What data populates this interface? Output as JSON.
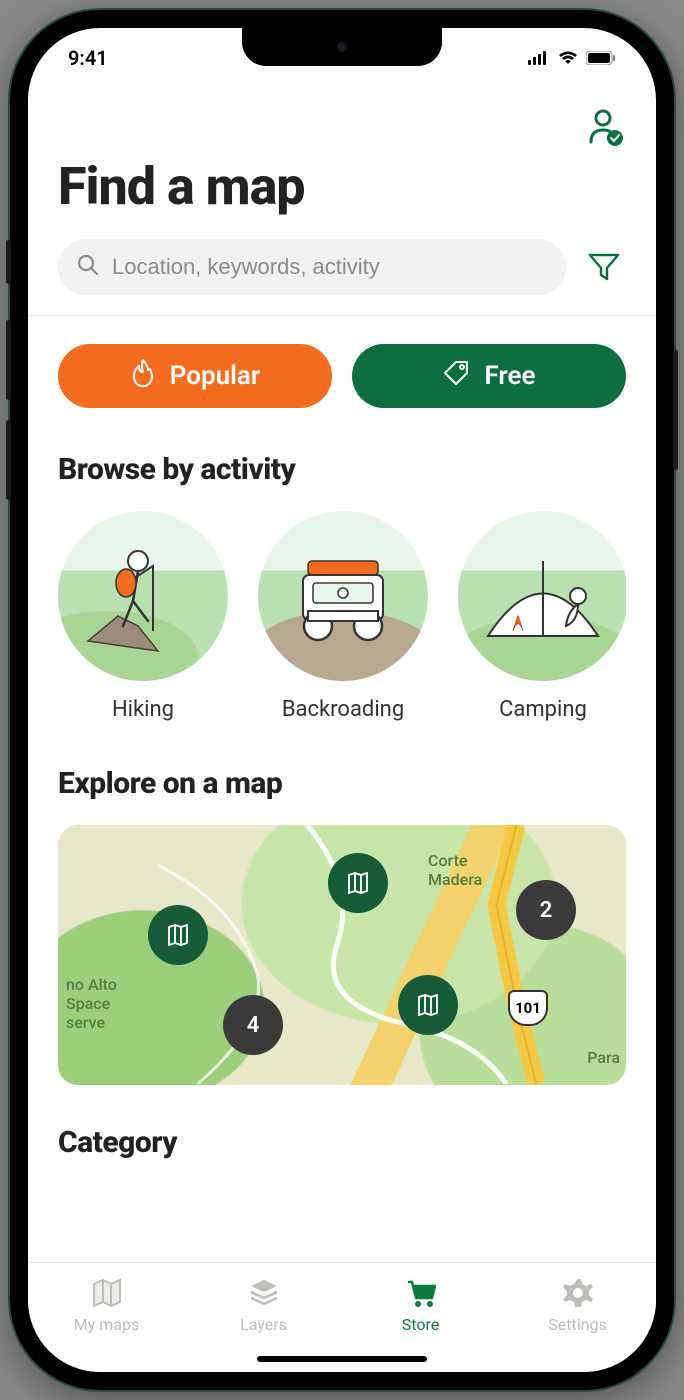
{
  "status": {
    "time": "9:41"
  },
  "header": {
    "title": "Find a map"
  },
  "search": {
    "placeholder": "Location, keywords, activity"
  },
  "pills": {
    "popular": {
      "label": "Popular",
      "color": "#f46c1f"
    },
    "free": {
      "label": "Free",
      "color": "#0c6e3f"
    }
  },
  "sections": {
    "browse_activity_title": "Browse by activity",
    "explore_map_title": "Explore on a map",
    "category_title": "Category"
  },
  "activities": [
    {
      "label": "Hiking",
      "icon": "hiker"
    },
    {
      "label": "Backroading",
      "icon": "jeep"
    },
    {
      "label": "Camping",
      "icon": "tent"
    }
  ],
  "map": {
    "labels": [
      {
        "text": "Corte Madera"
      },
      {
        "text": "no Alto Space serve"
      },
      {
        "text": "Para"
      }
    ],
    "highway": "101",
    "clusters": [
      {
        "count": "4"
      },
      {
        "count": "2"
      }
    ]
  },
  "tabs": [
    {
      "label": "My maps",
      "icon": "map",
      "active": false
    },
    {
      "label": "Layers",
      "icon": "layers",
      "active": false
    },
    {
      "label": "Store",
      "icon": "cart",
      "active": true
    },
    {
      "label": "Settings",
      "icon": "gear",
      "active": false
    }
  ]
}
